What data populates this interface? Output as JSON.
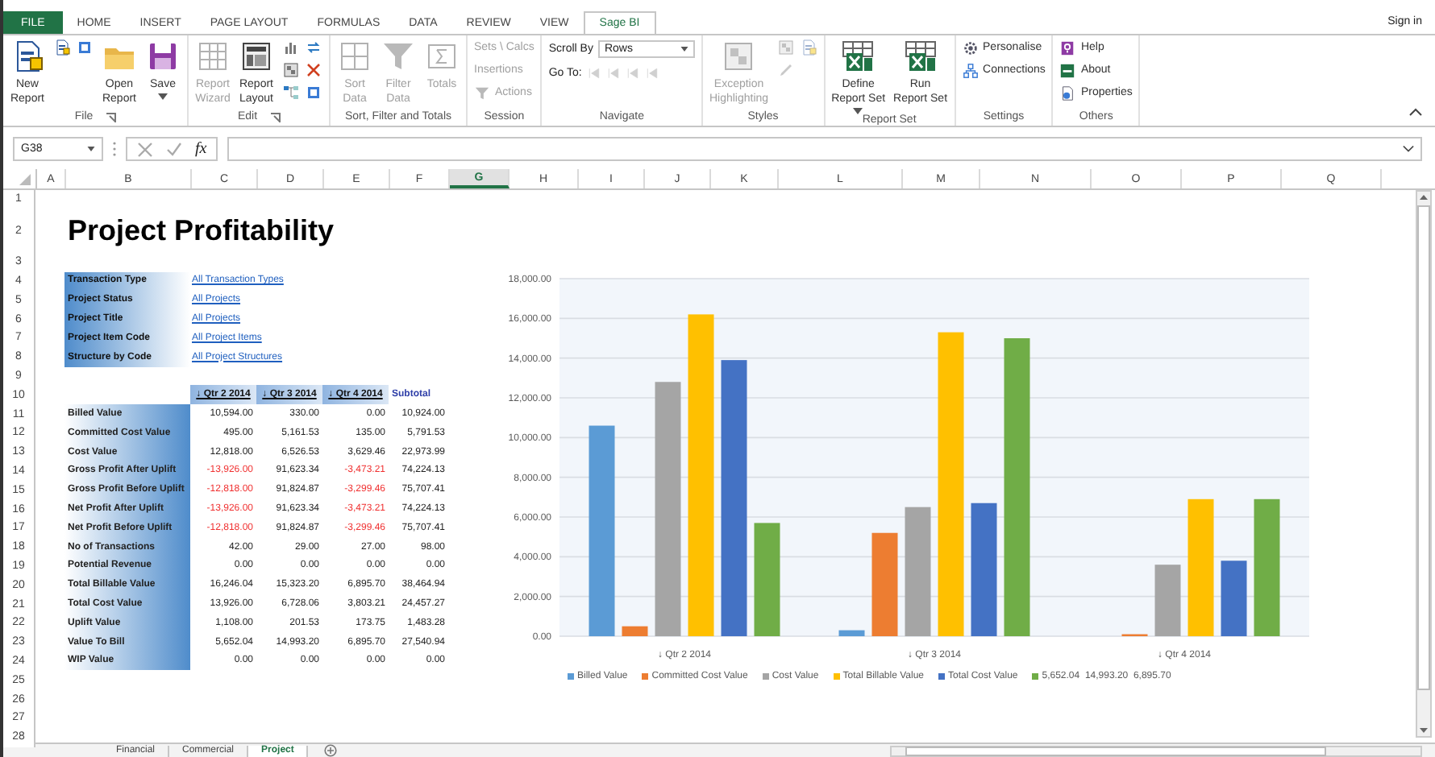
{
  "ribbon_tabs": [
    {
      "label": "FILE",
      "kind": "file",
      "selected": false
    },
    {
      "label": "HOME",
      "kind": "tab",
      "selected": false
    },
    {
      "label": "INSERT",
      "kind": "tab",
      "selected": false
    },
    {
      "label": "PAGE LAYOUT",
      "kind": "tab",
      "selected": false
    },
    {
      "label": "FORMULAS",
      "kind": "tab",
      "selected": false
    },
    {
      "label": "DATA",
      "kind": "tab",
      "selected": false
    },
    {
      "label": "REVIEW",
      "kind": "tab",
      "selected": false
    },
    {
      "label": "VIEW",
      "kind": "tab",
      "selected": false
    },
    {
      "label": "Sage BI",
      "kind": "tab",
      "selected": true
    }
  ],
  "account": {
    "label": "Sign in"
  },
  "ribbon_groups": [
    {
      "label": "File",
      "launcher": true,
      "items": [
        {
          "kind": "large",
          "label": "New\nReport",
          "disabled": false,
          "dropdown": false
        },
        {
          "kind": "icons",
          "disabled": false
        },
        {
          "kind": "large",
          "label": "Open\nReport",
          "disabled": false,
          "dropdown": false
        },
        {
          "kind": "large",
          "label": "Save",
          "disabled": false,
          "dropdown": true
        }
      ]
    },
    {
      "label": "Edit",
      "launcher": true,
      "items": [
        {
          "kind": "large",
          "label": "Report\nWizard",
          "disabled": true,
          "dropdown": false
        },
        {
          "kind": "large",
          "label": "Report\nLayout",
          "disabled": false,
          "dropdown": false
        },
        {
          "kind": "icons",
          "disabled": false
        }
      ]
    },
    {
      "label": "Sort, Filter and Totals",
      "launcher": false,
      "items": [
        {
          "kind": "large",
          "label": "Sort\nData",
          "disabled": true,
          "dropdown": false
        },
        {
          "kind": "large",
          "label": "Filter\nData",
          "disabled": true,
          "dropdown": false
        },
        {
          "kind": "large",
          "label": "Totals",
          "disabled": true,
          "dropdown": false
        }
      ]
    },
    {
      "label": "Session",
      "launcher": false,
      "items": [
        {
          "kind": "small",
          "label": "Sets \\ Calcs",
          "disabled": true,
          "icon": false
        },
        {
          "kind": "small",
          "label": "Insertions",
          "disabled": true,
          "icon": false
        },
        {
          "kind": "small",
          "label": "Actions",
          "disabled": true,
          "icon": true
        }
      ]
    },
    {
      "label": "Navigate",
      "launcher": false,
      "items": [
        {
          "kind": "select",
          "label": "Scroll By",
          "value": "Rows"
        },
        {
          "kind": "nav",
          "label": "Go To:",
          "disabled": true
        }
      ]
    },
    {
      "label": "Styles",
      "launcher": false,
      "items": [
        {
          "kind": "large",
          "label": "Exception\nHighlighting",
          "disabled": true,
          "dropdown": false
        },
        {
          "kind": "icons",
          "disabled": true
        }
      ]
    },
    {
      "label": "Report Set",
      "launcher": false,
      "items": [
        {
          "kind": "large",
          "label": "Define\nReport Set",
          "disabled": false,
          "dropdown": true
        },
        {
          "kind": "large",
          "label": "Run\nReport Set",
          "disabled": false,
          "dropdown": false
        }
      ]
    },
    {
      "label": "Settings",
      "launcher": false,
      "items": [
        {
          "kind": "small",
          "label": "Personalise",
          "disabled": false,
          "icon": true
        },
        {
          "kind": "small",
          "label": "Connections",
          "disabled": false,
          "icon": true
        }
      ]
    },
    {
      "label": "Others",
      "launcher": false,
      "items": [
        {
          "kind": "small",
          "label": "Help",
          "disabled": false,
          "icon": true
        },
        {
          "kind": "small",
          "label": "About",
          "disabled": false,
          "icon": true
        },
        {
          "kind": "small",
          "label": "Properties",
          "disabled": false,
          "icon": true
        }
      ]
    }
  ],
  "formula_bar": {
    "name_box": "G38",
    "function_label": "fx"
  },
  "columns": [
    {
      "label": "A",
      "selected": false
    },
    {
      "label": "B",
      "selected": false
    },
    {
      "label": "C",
      "selected": false
    },
    {
      "label": "D",
      "selected": false
    },
    {
      "label": "E",
      "selected": false
    },
    {
      "label": "F",
      "selected": false
    },
    {
      "label": "G",
      "selected": true
    },
    {
      "label": "H",
      "selected": false
    },
    {
      "label": "I",
      "selected": false
    },
    {
      "label": "J",
      "selected": false
    },
    {
      "label": "K",
      "selected": false
    },
    {
      "label": "L",
      "selected": false
    },
    {
      "label": "M",
      "selected": false
    },
    {
      "label": "N",
      "selected": false
    },
    {
      "label": "O",
      "selected": false
    },
    {
      "label": "P",
      "selected": false
    },
    {
      "label": "Q",
      "selected": false
    }
  ],
  "sheet_rows": [
    {
      "number": "1",
      "kind": "blank"
    },
    {
      "number": "2",
      "kind": "title",
      "text": "Project Profitability"
    },
    {
      "number": "3",
      "kind": "blank"
    },
    {
      "number": "4",
      "kind": "filter",
      "label": "Transaction Type",
      "value": "All Transaction Types"
    },
    {
      "number": "5",
      "kind": "filter",
      "label": "Project Status",
      "value": "All Projects"
    },
    {
      "number": "6",
      "kind": "filter",
      "label": "Project Title",
      "value": "All Projects"
    },
    {
      "number": "7",
      "kind": "filter",
      "label": "Project Item Code",
      "value": "All Project Items"
    },
    {
      "number": "8",
      "kind": "filter",
      "label": "Structure by Code",
      "value": "All Project Structures"
    },
    {
      "number": "9",
      "kind": "blank"
    },
    {
      "number": "10",
      "kind": "header",
      "headers": [
        "↓ Qtr 2 2014",
        "↓ Qtr 3 2014",
        "↓ Qtr 4 2014"
      ],
      "subtotal": "Subtotal"
    },
    {
      "number": "11",
      "kind": "data",
      "label": "Billed Value",
      "values": [
        {
          "text": "10,594.00",
          "negative": false
        },
        {
          "text": "330.00",
          "negative": false
        },
        {
          "text": "0.00",
          "negative": false
        },
        {
          "text": "10,924.00",
          "negative": false
        }
      ]
    },
    {
      "number": "12",
      "kind": "data",
      "label": "Committed Cost Value",
      "values": [
        {
          "text": "495.00",
          "negative": false
        },
        {
          "text": "5,161.53",
          "negative": false
        },
        {
          "text": "135.00",
          "negative": false
        },
        {
          "text": "5,791.53",
          "negative": false
        }
      ]
    },
    {
      "number": "13",
      "kind": "data",
      "label": "Cost Value",
      "values": [
        {
          "text": "12,818.00",
          "negative": false
        },
        {
          "text": "6,526.53",
          "negative": false
        },
        {
          "text": "3,629.46",
          "negative": false
        },
        {
          "text": "22,973.99",
          "negative": false
        }
      ]
    },
    {
      "number": "14",
      "kind": "data",
      "label": "Gross Profit After Uplift",
      "values": [
        {
          "text": "-13,926.00",
          "negative": true
        },
        {
          "text": "91,623.34",
          "negative": false
        },
        {
          "text": "-3,473.21",
          "negative": true
        },
        {
          "text": "74,224.13",
          "negative": false
        }
      ]
    },
    {
      "number": "15",
      "kind": "data",
      "label": "Gross Profit Before Uplift",
      "values": [
        {
          "text": "-12,818.00",
          "negative": true
        },
        {
          "text": "91,824.87",
          "negative": false
        },
        {
          "text": "-3,299.46",
          "negative": true
        },
        {
          "text": "75,707.41",
          "negative": false
        }
      ]
    },
    {
      "number": "16",
      "kind": "data",
      "label": "Net Profit After Uplift",
      "values": [
        {
          "text": "-13,926.00",
          "negative": true
        },
        {
          "text": "91,623.34",
          "negative": false
        },
        {
          "text": "-3,473.21",
          "negative": true
        },
        {
          "text": "74,224.13",
          "negative": false
        }
      ]
    },
    {
      "number": "17",
      "kind": "data",
      "label": "Net Profit Before Uplift",
      "values": [
        {
          "text": "-12,818.00",
          "negative": true
        },
        {
          "text": "91,824.87",
          "negative": false
        },
        {
          "text": "-3,299.46",
          "negative": true
        },
        {
          "text": "75,707.41",
          "negative": false
        }
      ]
    },
    {
      "number": "18",
      "kind": "data",
      "label": "No of Transactions",
      "values": [
        {
          "text": "42.00",
          "negative": false
        },
        {
          "text": "29.00",
          "negative": false
        },
        {
          "text": "27.00",
          "negative": false
        },
        {
          "text": "98.00",
          "negative": false
        }
      ]
    },
    {
      "number": "19",
      "kind": "data",
      "label": "Potential Revenue",
      "values": [
        {
          "text": "0.00",
          "negative": false
        },
        {
          "text": "0.00",
          "negative": false
        },
        {
          "text": "0.00",
          "negative": false
        },
        {
          "text": "0.00",
          "negative": false
        }
      ]
    },
    {
      "number": "20",
      "kind": "data",
      "label": "Total Billable Value",
      "values": [
        {
          "text": "16,246.04",
          "negative": false
        },
        {
          "text": "15,323.20",
          "negative": false
        },
        {
          "text": "6,895.70",
          "negative": false
        },
        {
          "text": "38,464.94",
          "negative": false
        }
      ]
    },
    {
      "number": "21",
      "kind": "data",
      "label": "Total Cost Value",
      "values": [
        {
          "text": "13,926.00",
          "negative": false
        },
        {
          "text": "6,728.06",
          "negative": false
        },
        {
          "text": "3,803.21",
          "negative": false
        },
        {
          "text": "24,457.27",
          "negative": false
        }
      ]
    },
    {
      "number": "22",
      "kind": "data",
      "label": "Uplift Value",
      "values": [
        {
          "text": "1,108.00",
          "negative": false
        },
        {
          "text": "201.53",
          "negative": false
        },
        {
          "text": "173.75",
          "negative": false
        },
        {
          "text": "1,483.28",
          "negative": false
        }
      ]
    },
    {
      "number": "23",
      "kind": "data",
      "label": "Value To Bill",
      "values": [
        {
          "text": "5,652.04",
          "negative": false
        },
        {
          "text": "14,993.20",
          "negative": false
        },
        {
          "text": "6,895.70",
          "negative": false
        },
        {
          "text": "27,540.94",
          "negative": false
        }
      ]
    },
    {
      "number": "24",
      "kind": "data",
      "label": "WIP Value",
      "values": [
        {
          "text": "0.00",
          "negative": false
        },
        {
          "text": "0.00",
          "negative": false
        },
        {
          "text": "0.00",
          "negative": false
        },
        {
          "text": "0.00",
          "negative": false
        }
      ]
    },
    {
      "number": "25",
      "kind": "blank"
    },
    {
      "number": "26",
      "kind": "blank"
    },
    {
      "number": "27",
      "kind": "blank"
    },
    {
      "number": "28",
      "kind": "blank"
    }
  ],
  "chart": {
    "chart_data": {
      "type": "bar",
      "categories": [
        "↓ Qtr 2 2014",
        "↓ Qtr 3 2014",
        "↓ Qtr 4 2014"
      ],
      "series": [
        {
          "name": "Billed Value",
          "color": "#5b9bd5",
          "values": [
            10600,
            300,
            0
          ]
        },
        {
          "name": "Committed Cost Value",
          "color": "#ed7d31",
          "values": [
            500,
            5200,
            100
          ]
        },
        {
          "name": "Cost Value",
          "color": "#a5a5a5",
          "values": [
            12800,
            6500,
            3600
          ]
        },
        {
          "name": "Total Billable Value",
          "color": "#ffc000",
          "values": [
            16200,
            15300,
            6900
          ]
        },
        {
          "name": "Total Cost Value",
          "color": "#4472c4",
          "values": [
            13900,
            6700,
            3800
          ]
        },
        {
          "name": "5,652.04  14,993.20  6,895.70",
          "color": "#70ad47",
          "values": [
            5700,
            15000,
            6900
          ]
        }
      ],
      "grid": true,
      "legend": true,
      "ylim": [
        0,
        18000
      ],
      "yticks": [
        {
          "value": 0,
          "label": "0.00"
        },
        {
          "value": 2000,
          "label": "2,000.00"
        },
        {
          "value": 4000,
          "label": "4,000.00"
        },
        {
          "value": 6000,
          "label": "6,000.00"
        },
        {
          "value": 8000,
          "label": "8,000.00"
        },
        {
          "value": 10000,
          "label": "10,000.00"
        },
        {
          "value": 12000,
          "label": "12,000.00"
        },
        {
          "value": 14000,
          "label": "14,000.00"
        },
        {
          "value": 16000,
          "label": "16,000.00"
        },
        {
          "value": 18000,
          "label": "18,000.00"
        }
      ]
    }
  },
  "sheet_tabs": [
    {
      "label": "Financial",
      "selected": false
    },
    {
      "label": "Commercial",
      "selected": false
    },
    {
      "label": "Project",
      "selected": true
    }
  ]
}
